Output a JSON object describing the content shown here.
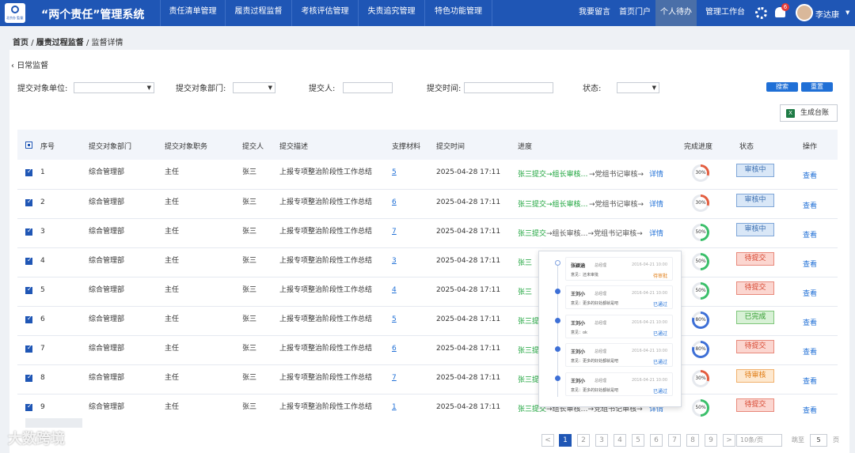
{
  "header": {
    "logo_text": "北京办 監督系統",
    "title": "“两个责任”管理系统",
    "nav": [
      "责任清单管理",
      "履责过程监督",
      "考核评估管理",
      "失责追究管理",
      "特色功能管理"
    ],
    "right_nav": [
      "我要留言",
      "首页门户",
      "个人待办",
      "管理工作台"
    ],
    "active_right": "个人待办",
    "notif_count": "6",
    "user": "李达康"
  },
  "breadcrumb": {
    "home": "首页",
    "sep1": "/",
    "parent": "履责过程监督",
    "sep2": "/",
    "current": "监督详情"
  },
  "back_label": "日常监督",
  "filters": {
    "unit_label": "提交对象单位:",
    "dept_label": "提交对象部门:",
    "submitter_label": "提交人:",
    "time_label": "提交时间:",
    "status_label": "状态:",
    "search_btn": "搜索",
    "reset_btn": "重置"
  },
  "ledger_btn": "生成台账",
  "table": {
    "headers": [
      "序号",
      "提交对象部门",
      "提交对象职务",
      "提交人",
      "提交描述",
      "支撑材料",
      "提交时间",
      "进度",
      "完成进度",
      "状态",
      "操作"
    ],
    "rows": [
      {
        "no": "1",
        "dept": "综合管理部",
        "duty": "主任",
        "submitter": "张三",
        "desc": "上报专项整治阶段性工作总结",
        "materials": "5",
        "time": "2025-04-28 17:11",
        "p1": "张三提交→组长审核…",
        "p2": "→党组书记审核→",
        "detail": "详情",
        "progress": 30,
        "status": "审核中",
        "status_kind": "blue",
        "action": "查看"
      },
      {
        "no": "2",
        "dept": "综合管理部",
        "duty": "主任",
        "submitter": "张三",
        "desc": "上报专项整治阶段性工作总结",
        "materials": "6",
        "time": "2025-04-28 17:11",
        "p1": "张三提交→组长审核…",
        "p2": "→党组书记审核→",
        "detail": "详情",
        "progress": 30,
        "status": "审核中",
        "status_kind": "blue",
        "action": "查看"
      },
      {
        "no": "3",
        "dept": "综合管理部",
        "duty": "主任",
        "submitter": "张三",
        "desc": "上报专项整治阶段性工作总结",
        "materials": "7",
        "time": "2025-04-28 17:11",
        "p1": "张三提交",
        "p2": "→组长审核…→党组书记审核→",
        "detail": "详情",
        "progress": 50,
        "status": "审核中",
        "status_kind": "blue",
        "action": "查看"
      },
      {
        "no": "4",
        "dept": "综合管理部",
        "duty": "主任",
        "submitter": "张三",
        "desc": "上报专项整治阶段性工作总结",
        "materials": "3",
        "time": "2025-04-28 17:11",
        "p1": "张三",
        "p2": "",
        "detail": "",
        "progress": 50,
        "status": "待提交",
        "status_kind": "red",
        "action": "查看"
      },
      {
        "no": "5",
        "dept": "综合管理部",
        "duty": "主任",
        "submitter": "张三",
        "desc": "上报专项整治阶段性工作总结",
        "materials": "4",
        "time": "2025-04-28 17:11",
        "p1": "张三",
        "p2": "",
        "detail": "",
        "progress": 50,
        "status": "待提交",
        "status_kind": "red",
        "action": "查看"
      },
      {
        "no": "6",
        "dept": "综合管理部",
        "duty": "主任",
        "submitter": "张三",
        "desc": "上报专项整治阶段性工作总结",
        "materials": "5",
        "time": "2025-04-28 17:11",
        "p1": "张三提",
        "p2": "",
        "detail": "",
        "progress": 80,
        "status": "已完成",
        "status_kind": "green",
        "action": "查看"
      },
      {
        "no": "7",
        "dept": "综合管理部",
        "duty": "主任",
        "submitter": "张三",
        "desc": "上报专项整治阶段性工作总结",
        "materials": "6",
        "time": "2025-04-28 17:11",
        "p1": "张三提",
        "p2": "",
        "detail": "",
        "progress": 80,
        "status": "待提交",
        "status_kind": "red",
        "action": "查看"
      },
      {
        "no": "8",
        "dept": "综合管理部",
        "duty": "主任",
        "submitter": "张三",
        "desc": "上报专项整治阶段性工作总结",
        "materials": "7",
        "time": "2025-04-28 17:11",
        "p1": "张三提",
        "p2": "",
        "detail": "",
        "progress": 30,
        "status": "待审核",
        "status_kind": "orange",
        "action": "查看"
      },
      {
        "no": "9",
        "dept": "综合管理部",
        "duty": "主任",
        "submitter": "张三",
        "desc": "上报专项整治阶段性工作总结",
        "materials": "1",
        "time": "2025-04-28 17:11",
        "p1": "张三提交",
        "p2": "→组长审核…→党组书记审核→",
        "detail": "详情",
        "progress": 50,
        "status": "待提交",
        "status_kind": "red",
        "action": "查看"
      }
    ]
  },
  "timeline": [
    {
      "name": "张颖涵",
      "role": "总经理",
      "time": "2016-04-21 10:00",
      "opinion": "意见：还未审批",
      "state": "待审批",
      "state_kind": "orange",
      "pending": true
    },
    {
      "name": "王刘小",
      "role": "总经理",
      "time": "2016-04-21 10:00",
      "opinion": "意见：更多的好处都就是吧",
      "state": "已通过",
      "state_kind": "blue",
      "pending": false
    },
    {
      "name": "王刘小",
      "role": "总经理",
      "time": "2016-04-21 10:00",
      "opinion": "意见：ok",
      "state": "已通过",
      "state_kind": "blue",
      "pending": false
    },
    {
      "name": "王刘小",
      "role": "总经理",
      "time": "2016-04-21 10:00",
      "opinion": "意见：更多的好处都就是吧",
      "state": "已通过",
      "state_kind": "blue",
      "pending": false
    },
    {
      "name": "王刘小",
      "role": "总经理",
      "time": "2016-04-21 10:00",
      "opinion": "意见：更多的好处都就是吧",
      "state": "已通过",
      "state_kind": "blue",
      "pending": false
    }
  ],
  "pagination": {
    "prev": "<",
    "pages": [
      "1",
      "2",
      "3",
      "4",
      "5",
      "6",
      "7",
      "8",
      "9"
    ],
    "next": ">",
    "current": "1",
    "page_size": "10条/页",
    "jump_label": "跳至",
    "jump_value": "5",
    "jump_unit": "页"
  },
  "watermark": "大数跨境",
  "colors": {
    "primary": "#1f56b5",
    "green": "#19a339",
    "red": "#d7452f",
    "orange": "#e07b12"
  }
}
